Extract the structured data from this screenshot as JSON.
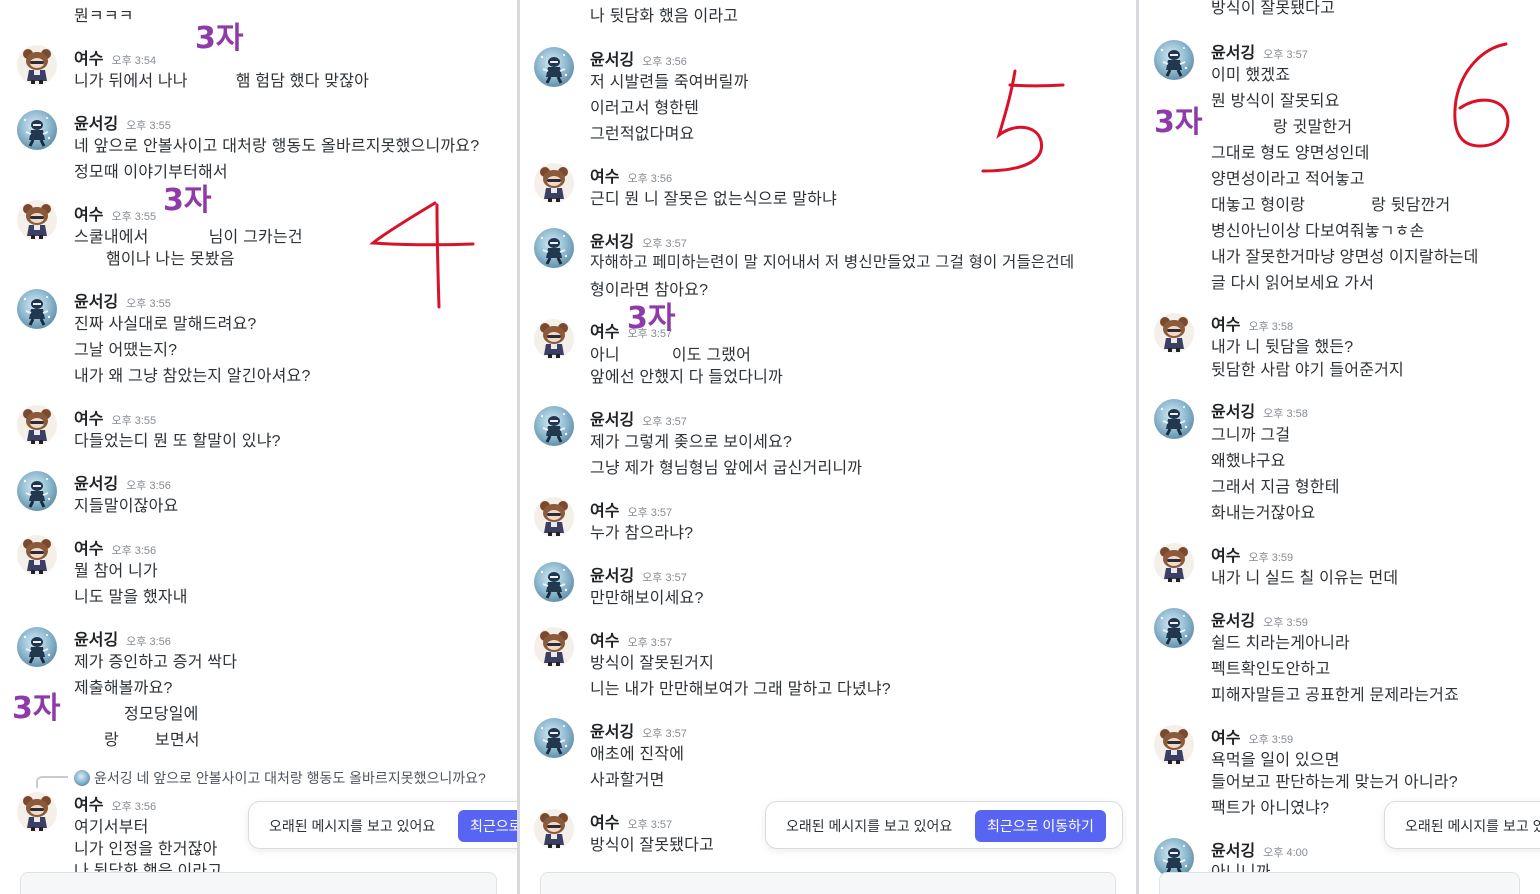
{
  "colors": {
    "annotation_purple": "#8e3aa8",
    "annotation_red": "#d9122a",
    "button_blue": "#5865f2"
  },
  "icons": {
    "avatar_yeosu": "bear-girl-avatar-icon",
    "avatar_yoon": "blue-sparkle-avatar-icon"
  },
  "panel1": {
    "top_line": "뭔ㅋㅋㅋ",
    "messages": [
      {
        "name": "여수",
        "time": "오후 3:54",
        "lines": [
          "니가 뒤에서 나나",
          "햄 험담 했다 맞잖아"
        ]
      },
      {
        "name": "윤서깅",
        "time": "오후 3:55",
        "lines": [
          "네 앞으로 안볼사이고 대처랑 행동도 올바르지못했으니까요?",
          "정모때 이야기부터해서"
        ]
      },
      {
        "name": "여수",
        "time": "오후 3:55",
        "lines": [
          "스쿨내에서",
          "님이 그카는건",
          "햄이나 나는 못봤음"
        ]
      },
      {
        "name": "윤서깅",
        "time": "오후 3:55",
        "lines": [
          "진짜 사실대로 말해드려요?",
          "그날 어땠는지?",
          "내가 왜 그냥 참았는지 알긴아셔요?"
        ]
      },
      {
        "name": "여수",
        "time": "오후 3:55",
        "lines": [
          "다들었는디 뭔 또 할말이 있냐?"
        ]
      },
      {
        "name": "윤서깅",
        "time": "오후 3:56",
        "lines": [
          "지들말이잖아요"
        ]
      },
      {
        "name": "여수",
        "time": "오후 3:56",
        "lines": [
          "뭘 참어 니가",
          "니도 말을 했자내"
        ]
      },
      {
        "name": "윤서깅",
        "time": "오후 3:56",
        "lines": [
          "제가 증인하고 증거 싹다",
          "제출해볼까요?",
          "정모당일에",
          "랑",
          "보면서"
        ]
      },
      {
        "name": "여수",
        "time": "오후 3:56",
        "reply": "윤서깅 네 앞으로 안볼사이고 대처랑 행동도 올바르지못했으니까요?",
        "lines": [
          "여기서부터",
          "니가 인정을 한거잖아",
          "나 뒷담화 했음 이라고"
        ]
      }
    ],
    "annotations": [
      "3자",
      "3자",
      "3자",
      "4"
    ],
    "banner": {
      "text": "오래된 메시지를 보고 있어요",
      "button": "최근으로 이동하기"
    }
  },
  "panel2": {
    "top_line": "나 뒷담화 했음 이라고",
    "messages": [
      {
        "name": "윤서깅",
        "time": "오후 3:56",
        "lines": [
          "저 시발련들 죽여버릴까",
          "이러고서 형한텐",
          "그런적없다며요"
        ]
      },
      {
        "name": "여수",
        "time": "오후 3:56",
        "lines": [
          "근디 뭔 니 잘못은 없는식으로 말하냐"
        ]
      },
      {
        "name": "윤서깅",
        "time": "오후 3:57",
        "lines": [
          "자해하고 페미하는련이 말 지어내서 저 병신만들었고 그걸 형이 거들은건데",
          "형이라면 참아요?"
        ]
      },
      {
        "name": "여수",
        "time": "오후 3:57",
        "lines": [
          "아니",
          "이도 그랬어",
          "앞에선 안했지  다 들었다니까"
        ]
      },
      {
        "name": "윤서깅",
        "time": "오후 3:57",
        "lines": [
          "제가 그렇게 좆으로 보이세요?",
          "그냥 제가 형님형님 앞에서 굽신거리니까"
        ]
      },
      {
        "name": "여수",
        "time": "오후 3:57",
        "lines": [
          "누가 참으라냐?"
        ]
      },
      {
        "name": "윤서깅",
        "time": "오후 3:57",
        "lines": [
          "만만해보이세요?"
        ]
      },
      {
        "name": "여수",
        "time": "오후 3:57",
        "lines": [
          "방식이 잘못된거지",
          "니는 내가 만만해보여가 그래 말하고 다녔냐?"
        ]
      },
      {
        "name": "윤서깅",
        "time": "오후 3:57",
        "lines": [
          "애초에 진작에",
          "사과할거면"
        ]
      },
      {
        "name": "여수",
        "time": "오후 3:57",
        "lines": [
          "방식이 잘못됐다고"
        ]
      }
    ],
    "annotations": [
      "3자",
      "5"
    ],
    "banner": {
      "text": "오래된 메시지를 보고 있어요",
      "button": "최근으로 이동하기"
    }
  },
  "panel3": {
    "top_line": "방식이 잘못됐다고",
    "messages": [
      {
        "name": "윤서깅",
        "time": "오후 3:57",
        "lines": [
          "이미 했겠죠",
          "뭔 방식이 잘못되요",
          "랑 귓말한거",
          "그대로 형도 양면성인데",
          "양면성이라고 적어놓고",
          "대놓고 형이랑",
          "랑 뒷담깐거",
          "병신아닌이상 다보여줘놓ㄱㅎ손",
          "내가 잘못한거마냥 양면성 이지랄하는데",
          "글 다시 읽어보세요 가서"
        ]
      },
      {
        "name": "여수",
        "time": "오후 3:58",
        "lines": [
          "내가 니 뒷담을 했든?",
          "뒷담한 사람 야기 들어준거지"
        ]
      },
      {
        "name": "윤서깅",
        "time": "오후 3:58",
        "lines": [
          "그니까 그걸",
          "왜했냐구요",
          "그래서 지금 형한테",
          "화내는거잖아요"
        ]
      },
      {
        "name": "여수",
        "time": "오후 3:59",
        "lines": [
          "내가 니 실드 칠 이유는 먼데"
        ]
      },
      {
        "name": "윤서깅",
        "time": "오후 3:59",
        "lines": [
          "쉴드 치라는게아니라",
          "펙트확인도안하고",
          "피해자말듣고 공표한게 문제라는거죠"
        ]
      },
      {
        "name": "여수",
        "time": "오후 3:59",
        "lines": [
          "욕먹을 일이 있으면",
          "들어보고 판단하는게 맞는거 아니라?",
          "팩트가 아니였냐?"
        ]
      },
      {
        "name": "윤서깅",
        "time": "오후 4:00",
        "lines": [
          "아니니까"
        ]
      }
    ],
    "annotations": [
      "3자",
      "6"
    ],
    "banner": {
      "text": "오래된 메시지를 보고 있어요"
    }
  }
}
